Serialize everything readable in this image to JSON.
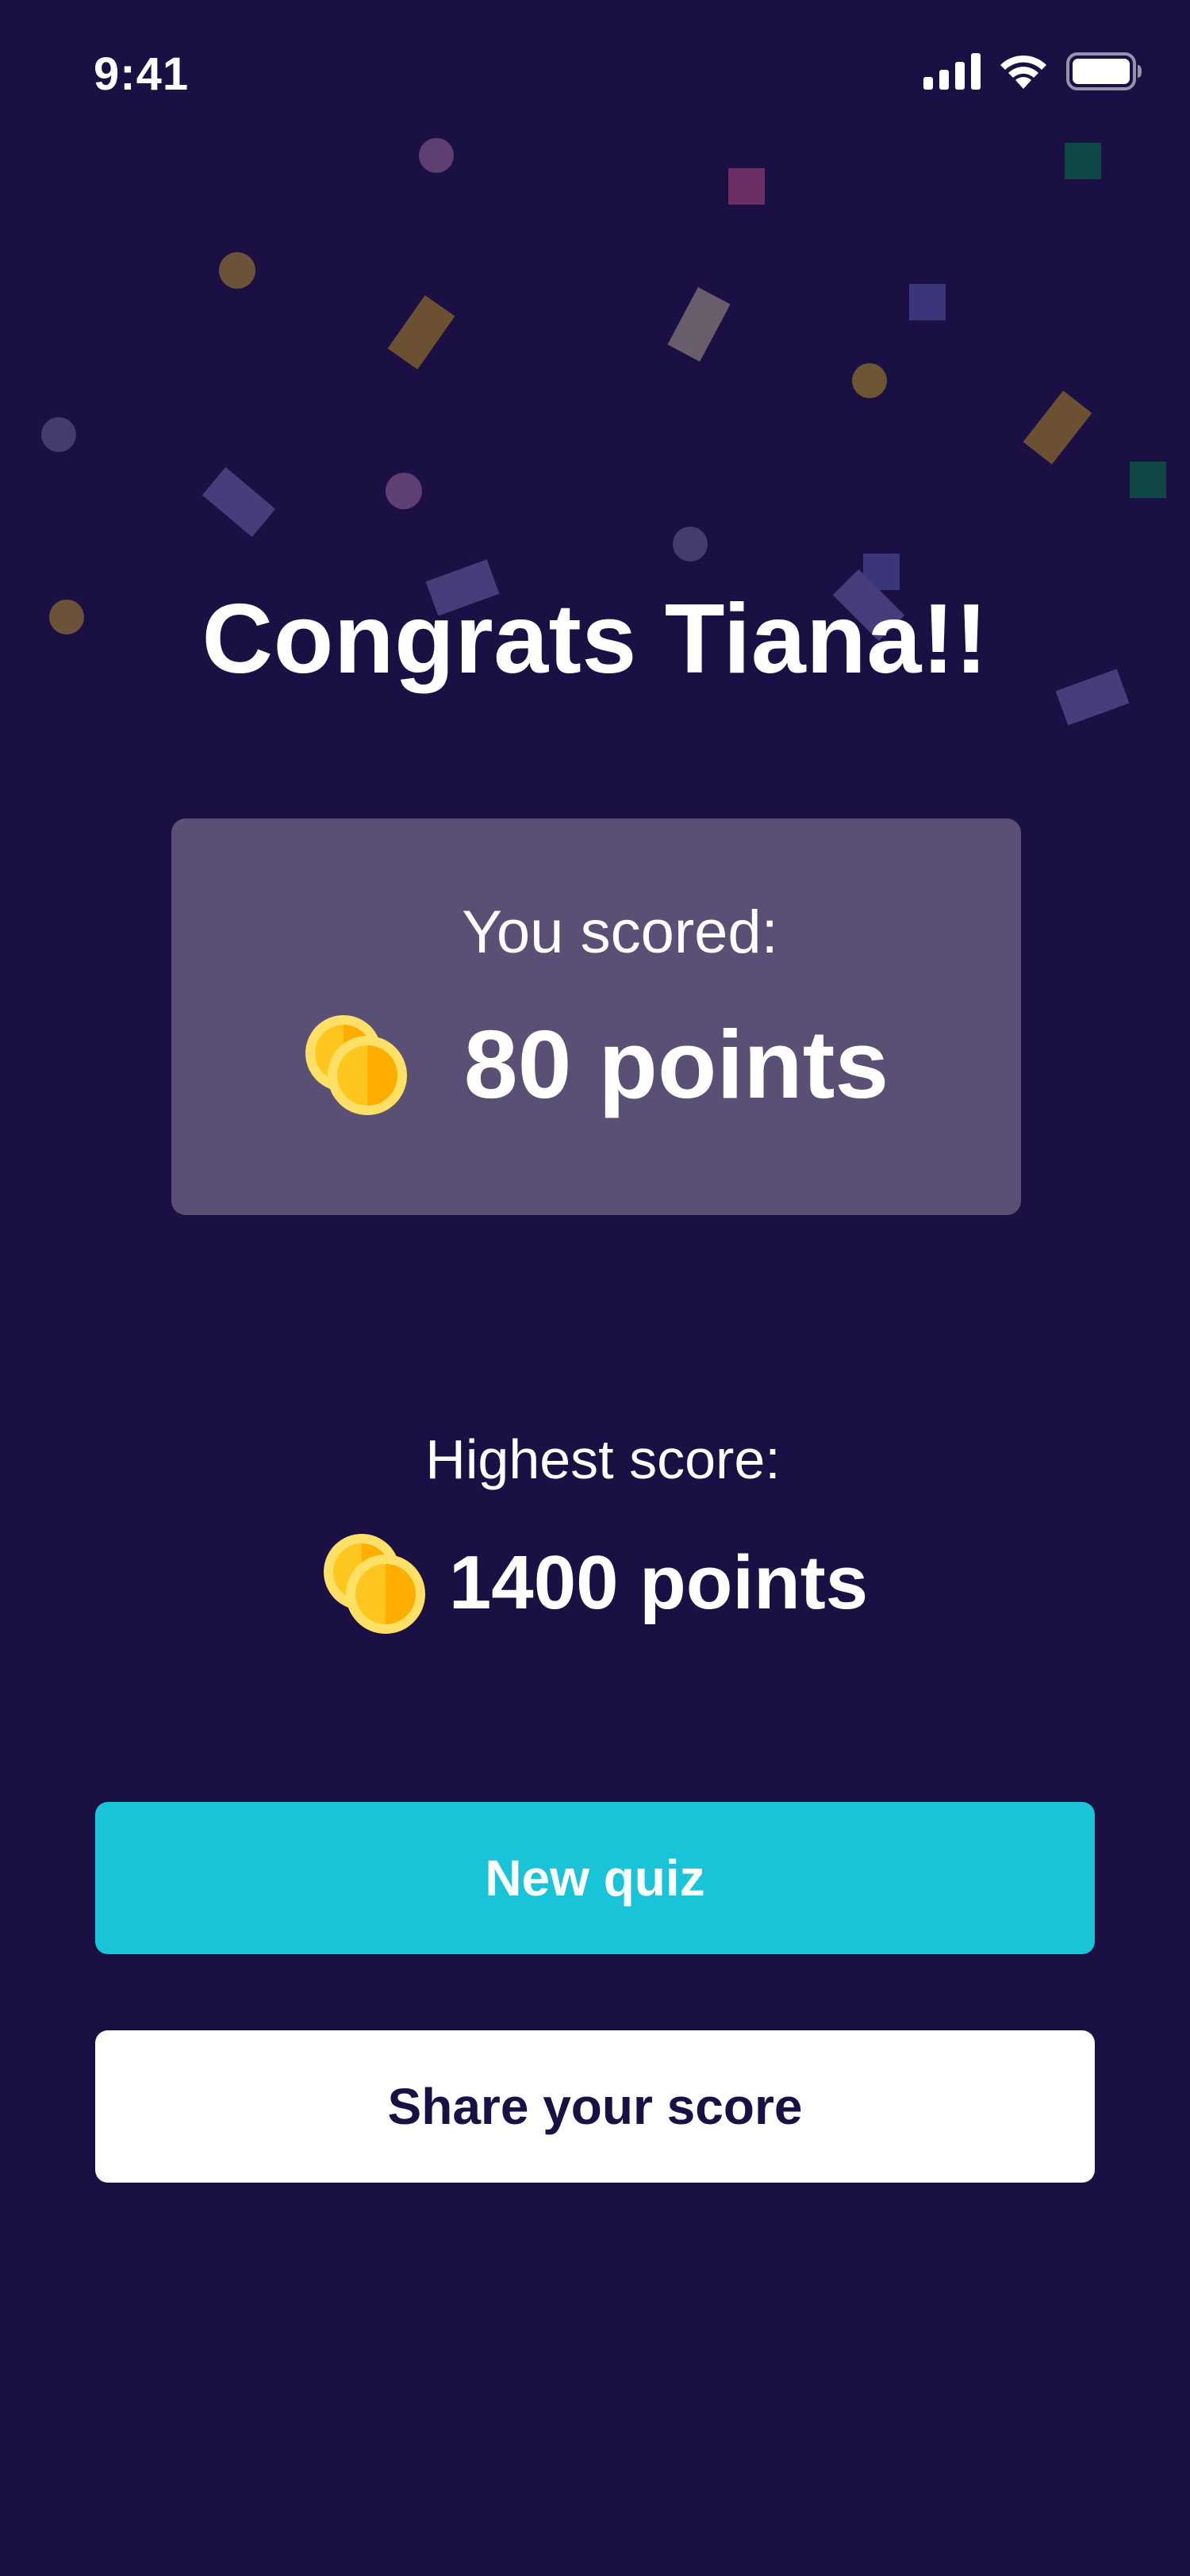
{
  "status_bar": {
    "time": "9:41",
    "icons": [
      "cellular-signal-icon",
      "wifi-icon",
      "battery-icon"
    ]
  },
  "result": {
    "title": "Congrats Tiana!!",
    "score_label": "You scored:",
    "score_value": "80 points",
    "highest_label": "Highest score:",
    "highest_value": "1400 points",
    "coin_icon": "coins-icon"
  },
  "actions": {
    "new_quiz_label": "New quiz",
    "share_label": "Share your score"
  },
  "colors": {
    "background": "#1b1044",
    "card": "#5a5076",
    "primary_button": "#19c3d8",
    "secondary_button": "#ffffff",
    "secondary_button_text": "#1b1044",
    "coin_gold": "#ffc61f",
    "coin_light": "#ffe066"
  }
}
